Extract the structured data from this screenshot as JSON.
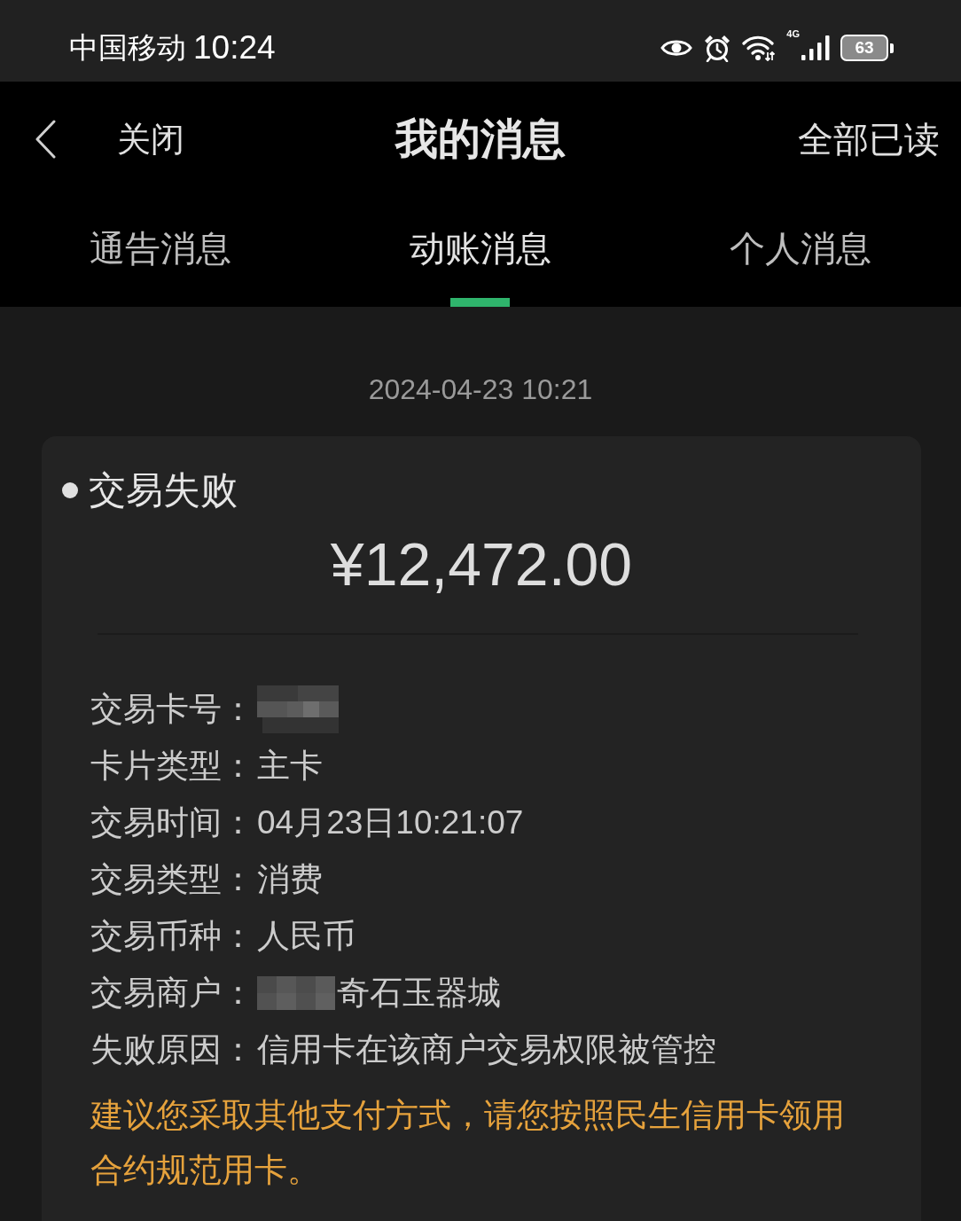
{
  "status_bar": {
    "carrier": "中国移动",
    "time": "10:24",
    "network_type": "4G",
    "battery": "63"
  },
  "nav_bar": {
    "back_label": "关闭",
    "title": "我的消息",
    "action": "全部已读"
  },
  "tabs": [
    {
      "label": "通告消息",
      "selected": false
    },
    {
      "label": "动账消息",
      "selected": true
    },
    {
      "label": "个人消息",
      "selected": false
    }
  ],
  "messages": [
    {
      "timestamp": "2024-04-23 10:21",
      "title": "交易失败",
      "amount": "¥12,472.00",
      "fields": [
        {
          "kind": "redacted",
          "label": "交易卡号："
        },
        {
          "kind": "text",
          "label": "卡片类型：",
          "value": "主卡"
        },
        {
          "kind": "text",
          "label": "交易时间：",
          "value": "04月23日10:21:07"
        },
        {
          "kind": "text",
          "label": "交易类型：",
          "value": "消费"
        },
        {
          "kind": "text",
          "label": "交易币种：",
          "value": "人民币"
        },
        {
          "kind": "redacted_prefix",
          "label": "交易商户：",
          "value": "奇石玉器城"
        },
        {
          "kind": "text",
          "label": "失败原因：",
          "value": "信用卡在该商户交易权限被管控"
        }
      ],
      "notice": "建议您采取其他支付方式，请您按照民生信用卡领用合约规范用卡。"
    }
  ]
}
